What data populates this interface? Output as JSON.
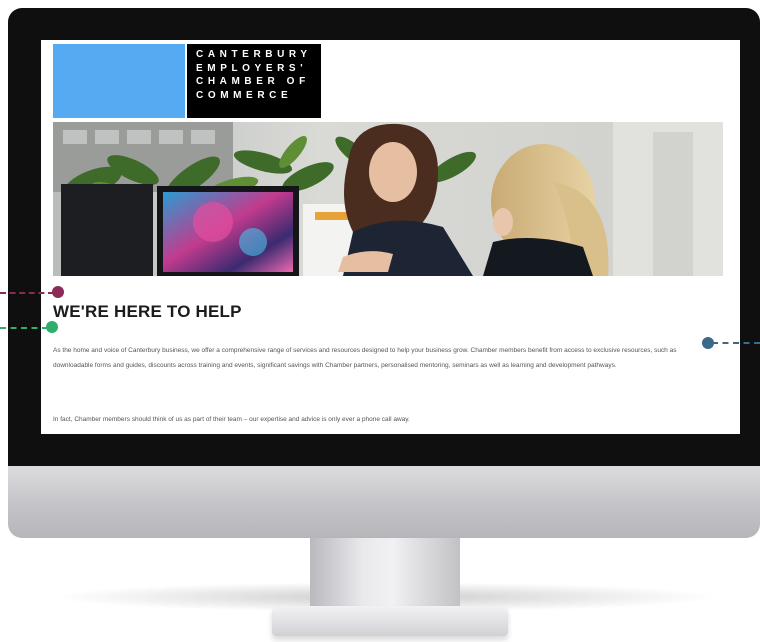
{
  "brand": {
    "logo_lines": [
      "CANTERBURY",
      "EMPLOYERS'",
      "CHAMBER OF",
      "COMMERCE"
    ],
    "logo_color": "#55aaf2"
  },
  "hero": {
    "photo_description_icon": "office-photo"
  },
  "content": {
    "heading": "WE'RE HERE TO HELP",
    "paragraph_1": "As the home and voice of Canterbury business, we offer a comprehensive range of services and resources designed to help your business grow. Chamber members benefit from access to exclusive resources, such as downloadable forms and guides, discounts across training and events, significant savings with Chamber partners, personalised mentoring, seminars as well as learning and development pathways.",
    "paragraph_2": "In fact, Chamber members should think of us as part of their team – our expertise and advice is only ever a phone call away."
  },
  "callouts": {
    "colors": {
      "maroon": "#8b2a57",
      "green": "#2fae6b",
      "slate": "#3a6a8a"
    }
  }
}
